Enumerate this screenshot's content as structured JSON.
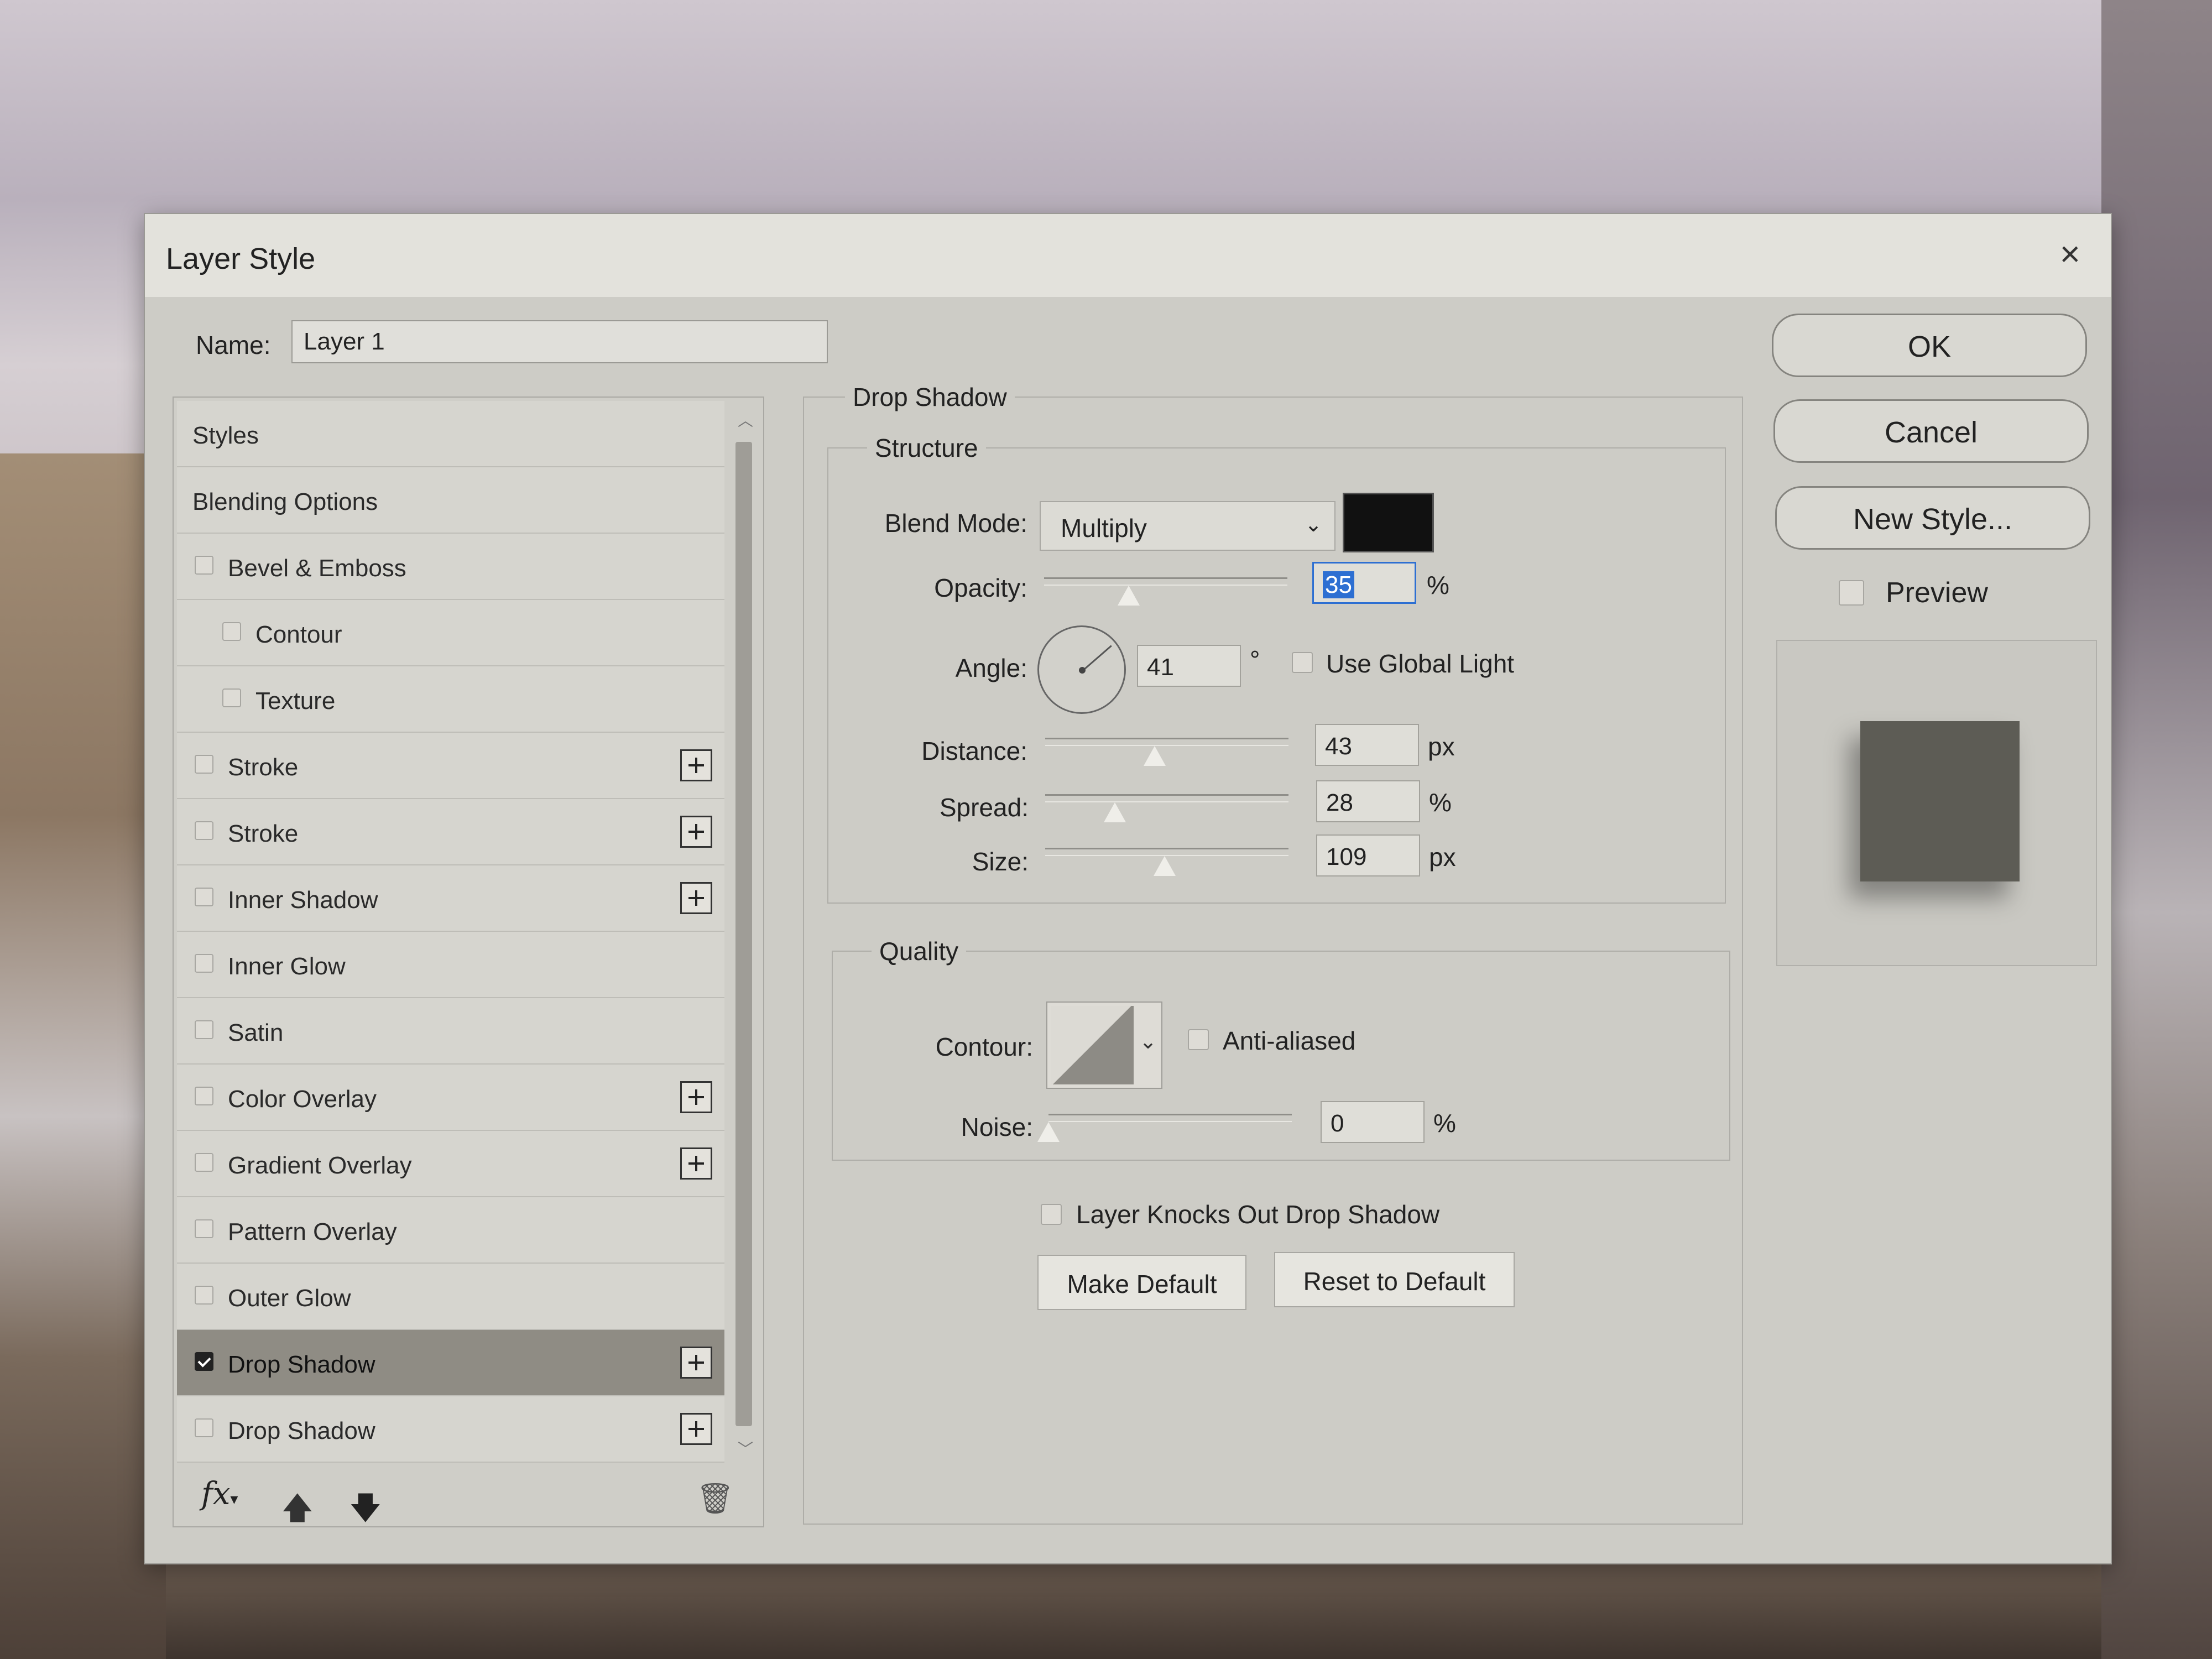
{
  "dialog": {
    "title": "Layer Style",
    "close_icon": "×"
  },
  "name": {
    "label": "Name:",
    "value": "Layer 1"
  },
  "styles_list": [
    {
      "label": "Styles",
      "kind": "header"
    },
    {
      "label": "Blending Options",
      "kind": "header"
    },
    {
      "label": "Bevel & Emboss",
      "kind": "check",
      "checked": false,
      "plus": false,
      "sub": false
    },
    {
      "label": "Contour",
      "kind": "check",
      "checked": false,
      "plus": false,
      "sub": true
    },
    {
      "label": "Texture",
      "kind": "check",
      "checked": false,
      "plus": false,
      "sub": true
    },
    {
      "label": "Stroke",
      "kind": "check",
      "checked": false,
      "plus": true,
      "sub": false
    },
    {
      "label": "Stroke",
      "kind": "check",
      "checked": false,
      "plus": true,
      "sub": false
    },
    {
      "label": "Inner Shadow",
      "kind": "check",
      "checked": false,
      "plus": true,
      "sub": false
    },
    {
      "label": "Inner Glow",
      "kind": "check",
      "checked": false,
      "plus": false,
      "sub": false
    },
    {
      "label": "Satin",
      "kind": "check",
      "checked": false,
      "plus": false,
      "sub": false
    },
    {
      "label": "Color Overlay",
      "kind": "check",
      "checked": false,
      "plus": true,
      "sub": false
    },
    {
      "label": "Gradient Overlay",
      "kind": "check",
      "checked": false,
      "plus": true,
      "sub": false
    },
    {
      "label": "Pattern Overlay",
      "kind": "check",
      "checked": false,
      "plus": false,
      "sub": false
    },
    {
      "label": "Outer Glow",
      "kind": "check",
      "checked": false,
      "plus": false,
      "sub": false
    },
    {
      "label": "Drop Shadow",
      "kind": "check",
      "checked": true,
      "plus": true,
      "sub": false,
      "selected": true
    },
    {
      "label": "Drop Shadow",
      "kind": "check",
      "checked": false,
      "plus": true,
      "sub": false
    }
  ],
  "bottom_tools": {
    "fx_label": "fx",
    "fx_caret": "▾",
    "up_icon": "🡅",
    "down_icon": "🡇",
    "trash_icon": "🗑"
  },
  "drop_shadow": {
    "title": "Drop Shadow",
    "structure": {
      "title": "Structure",
      "blend_mode_label": "Blend Mode:",
      "blend_mode_value": "Multiply",
      "shadow_color": "#111111",
      "opacity_label": "Opacity:",
      "opacity_value": "35",
      "opacity_unit": "%",
      "angle_label": "Angle:",
      "angle_value": "41",
      "angle_unit": "°",
      "use_global_light_label": "Use Global Light",
      "use_global_light": false,
      "distance_label": "Distance:",
      "distance_value": "43",
      "distance_unit": "px",
      "spread_label": "Spread:",
      "spread_value": "28",
      "spread_unit": "%",
      "size_label": "Size:",
      "size_value": "109",
      "size_unit": "px"
    },
    "quality": {
      "title": "Quality",
      "contour_label": "Contour:",
      "anti_aliased_label": "Anti-aliased",
      "anti_aliased": false,
      "noise_label": "Noise:",
      "noise_value": "0",
      "noise_unit": "%"
    },
    "knocks_out_label": "Layer Knocks Out Drop Shadow",
    "knocks_out": true,
    "make_default_label": "Make Default",
    "reset_default_label": "Reset to Default"
  },
  "buttons": {
    "ok": "OK",
    "cancel": "Cancel",
    "new_style": "New Style..."
  },
  "preview": {
    "label": "Preview",
    "checked": true,
    "swatch_color": "#5d5c55"
  },
  "caret_icon": "⌄"
}
